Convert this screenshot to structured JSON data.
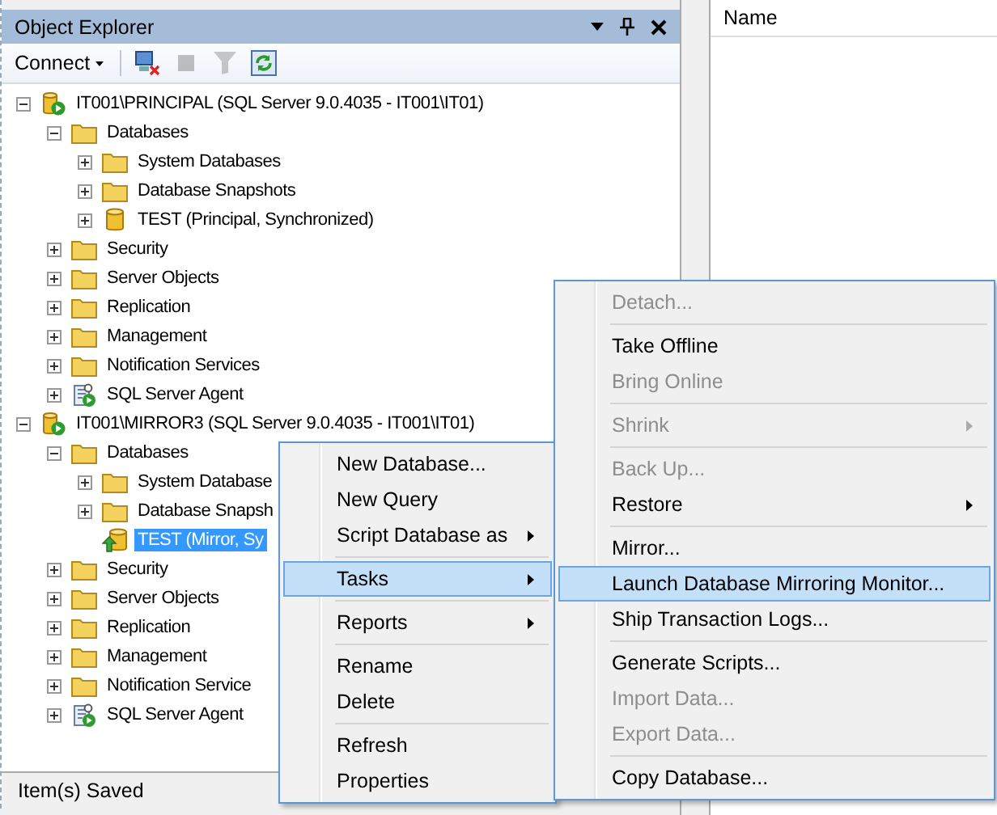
{
  "panel": {
    "title": "Object Explorer"
  },
  "toolbar": {
    "connect": "Connect",
    "tools": [
      {
        "kind": "disconnect",
        "disabled": false
      },
      {
        "kind": "stop",
        "disabled": true
      },
      {
        "kind": "filter",
        "disabled": true
      },
      {
        "kind": "refresh",
        "disabled": false
      }
    ]
  },
  "tree": [
    {
      "kind": "server",
      "label": "IT001\\PRINCIPAL (SQL Server 9.0.4035 - IT001\\IT01)",
      "expanded": true,
      "selected": false,
      "children": [
        {
          "kind": "folder",
          "label": "Databases",
          "expanded": true,
          "selected": false,
          "children": [
            {
              "kind": "folder",
              "label": "System Databases",
              "expanded": false,
              "selected": false
            },
            {
              "kind": "folder",
              "label": "Database Snapshots",
              "expanded": false,
              "selected": false
            },
            {
              "kind": "database",
              "label": "TEST (Principal, Synchronized)",
              "expanded": false,
              "selected": false
            }
          ]
        },
        {
          "kind": "folder",
          "label": "Security",
          "expanded": false,
          "selected": false
        },
        {
          "kind": "folder",
          "label": "Server Objects",
          "expanded": false,
          "selected": false
        },
        {
          "kind": "folder",
          "label": "Replication",
          "expanded": false,
          "selected": false
        },
        {
          "kind": "folder",
          "label": "Management",
          "expanded": false,
          "selected": false
        },
        {
          "kind": "folder",
          "label": "Notification Services",
          "expanded": false,
          "selected": false
        },
        {
          "kind": "agent",
          "label": "SQL Server Agent",
          "expanded": false,
          "selected": false
        }
      ]
    },
    {
      "kind": "server",
      "label": "IT001\\MIRROR3 (SQL Server 9.0.4035 - IT001\\IT01)",
      "expanded": true,
      "selected": false,
      "children": [
        {
          "kind": "folder",
          "label": "Databases",
          "expanded": true,
          "selected": false,
          "children": [
            {
              "kind": "folder",
              "label": "System Database",
              "expanded": false,
              "selected": false
            },
            {
              "kind": "folder",
              "label": "Database Snapsh",
              "expanded": false,
              "selected": false
            },
            {
              "kind": "mirror",
              "label": "TEST (Mirror, Sy",
              "selected": true
            }
          ]
        },
        {
          "kind": "folder",
          "label": "Security",
          "expanded": false,
          "selected": false
        },
        {
          "kind": "folder",
          "label": "Server Objects",
          "expanded": false,
          "selected": false
        },
        {
          "kind": "folder",
          "label": "Replication",
          "expanded": false,
          "selected": false
        },
        {
          "kind": "folder",
          "label": "Management",
          "expanded": false,
          "selected": false
        },
        {
          "kind": "folder",
          "label": "Notification Service",
          "expanded": false,
          "selected": false
        },
        {
          "kind": "agent",
          "label": "SQL Server Agent",
          "expanded": false,
          "selected": false
        }
      ]
    }
  ],
  "status_bar": "Item(s) Saved",
  "list_header": "Name",
  "context_menu": [
    [
      {
        "label": "New Database...",
        "disabled": false,
        "submenu": false,
        "selected": false
      },
      {
        "label": "New Query",
        "disabled": false,
        "submenu": false,
        "selected": false
      },
      {
        "label": "Script Database as",
        "disabled": false,
        "submenu": true,
        "selected": false
      }
    ],
    [
      {
        "label": "Tasks",
        "disabled": false,
        "submenu": true,
        "selected": true
      }
    ],
    [
      {
        "label": "Reports",
        "disabled": false,
        "submenu": true,
        "selected": false
      }
    ],
    [
      {
        "label": "Rename",
        "disabled": false,
        "submenu": false,
        "selected": false
      },
      {
        "label": "Delete",
        "disabled": false,
        "submenu": false,
        "selected": false
      }
    ],
    [
      {
        "label": "Refresh",
        "disabled": false,
        "submenu": false,
        "selected": false
      },
      {
        "label": "Properties",
        "disabled": false,
        "submenu": false,
        "selected": false
      }
    ]
  ],
  "tasks_submenu": [
    [
      {
        "label": "Detach...",
        "disabled": true,
        "submenu": false,
        "selected": false
      }
    ],
    [
      {
        "label": "Take Offline",
        "disabled": false,
        "submenu": false,
        "selected": false
      },
      {
        "label": "Bring Online",
        "disabled": true,
        "submenu": false,
        "selected": false
      }
    ],
    [
      {
        "label": "Shrink",
        "disabled": true,
        "submenu": true,
        "selected": false
      }
    ],
    [
      {
        "label": "Back Up...",
        "disabled": true,
        "submenu": false,
        "selected": false
      },
      {
        "label": "Restore",
        "disabled": false,
        "submenu": true,
        "selected": false
      }
    ],
    [
      {
        "label": "Mirror...",
        "disabled": false,
        "submenu": false,
        "selected": false
      },
      {
        "label": "Launch Database Mirroring Monitor...",
        "disabled": false,
        "submenu": false,
        "selected": true
      },
      {
        "label": "Ship Transaction Logs...",
        "disabled": false,
        "submenu": false,
        "selected": false
      }
    ],
    [
      {
        "label": "Generate Scripts...",
        "disabled": false,
        "submenu": false,
        "selected": false
      },
      {
        "label": "Import Data...",
        "disabled": true,
        "submenu": false,
        "selected": false
      },
      {
        "label": "Export Data...",
        "disabled": true,
        "submenu": false,
        "selected": false
      }
    ],
    [
      {
        "label": "Copy Database...",
        "disabled": false,
        "submenu": false,
        "selected": false
      }
    ]
  ]
}
